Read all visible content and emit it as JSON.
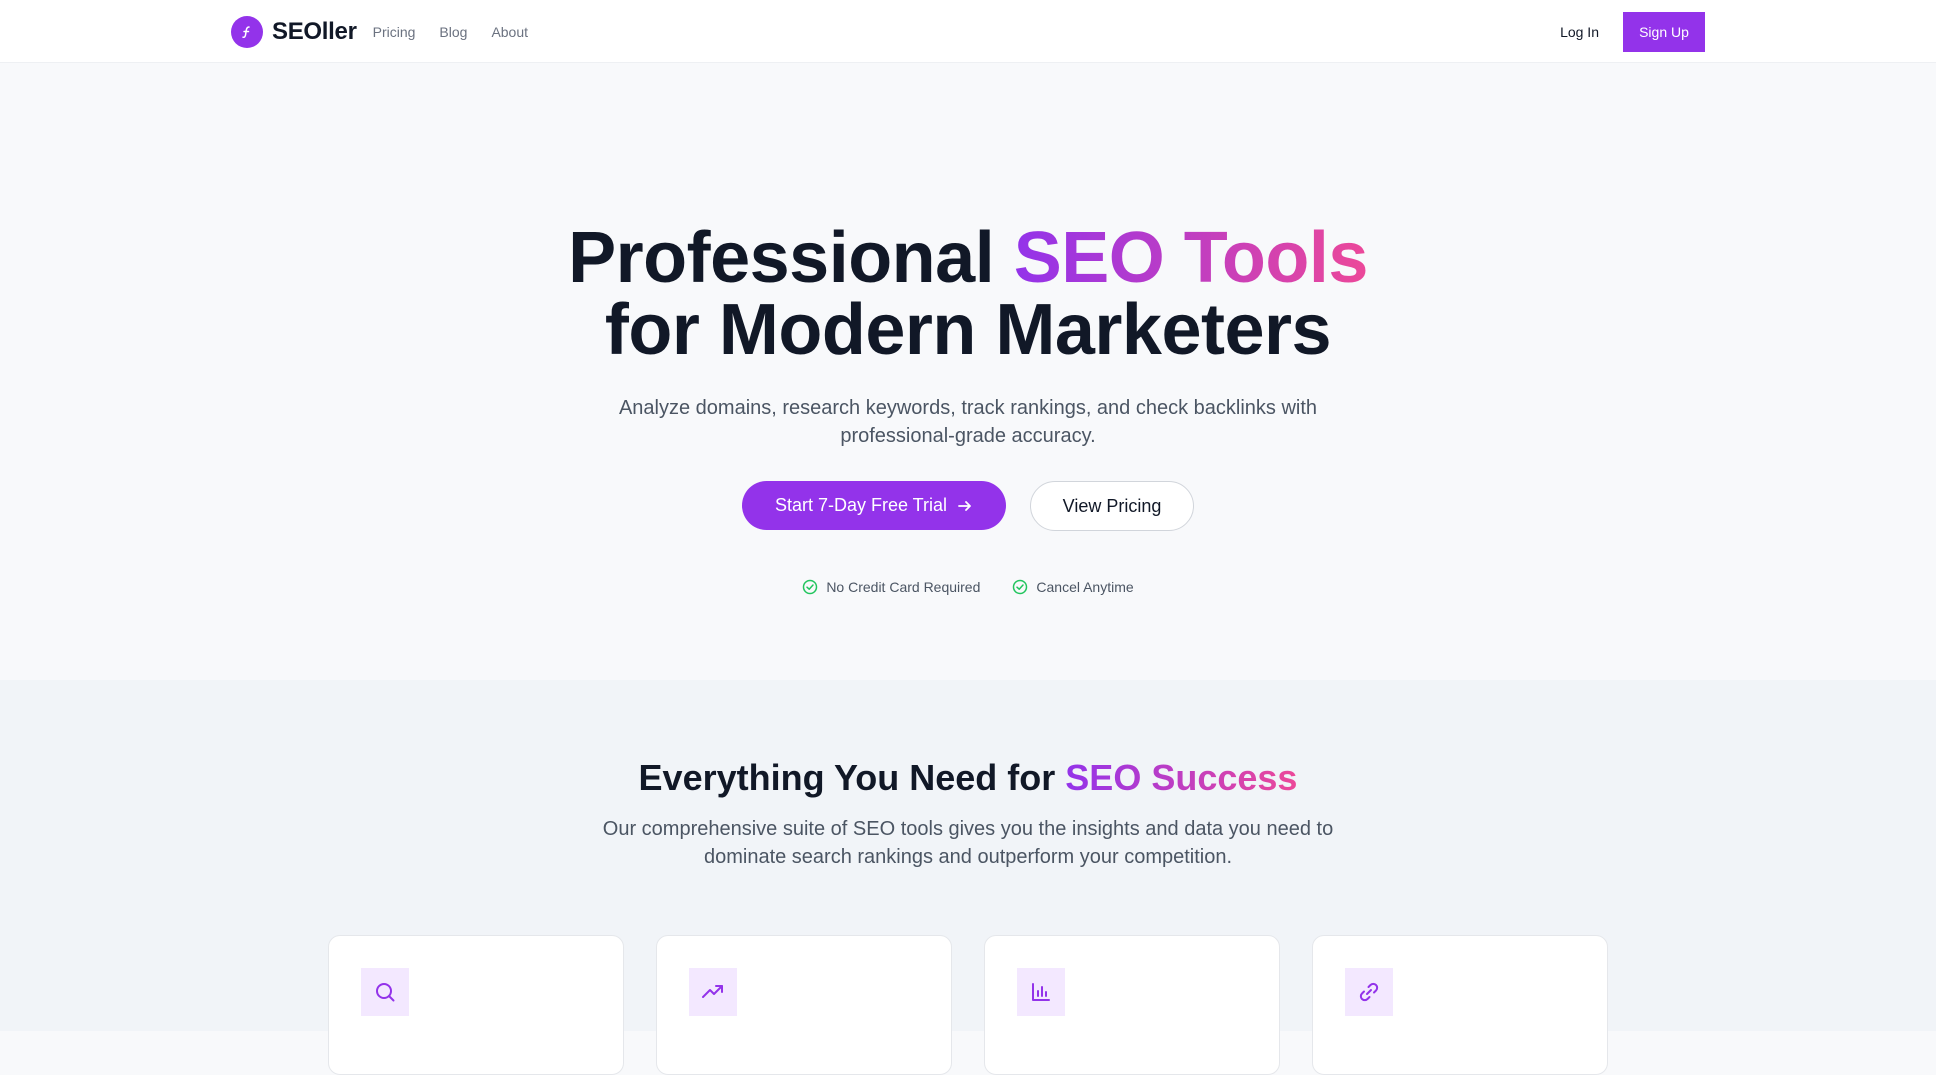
{
  "nav": {
    "brand": "SEOller",
    "links": [
      "Pricing",
      "Blog",
      "About"
    ],
    "login": "Log In",
    "signup": "Sign Up"
  },
  "hero": {
    "title_part1": "Professional ",
    "title_highlight": "SEO Tools",
    "title_part2": "for Modern Marketers",
    "subtitle": "Analyze domains, research keywords, track rankings, and check backlinks with professional-grade accuracy.",
    "cta_primary": "Start 7-Day Free Trial",
    "cta_secondary": "View Pricing",
    "badges": [
      "No Credit Card Required",
      "Cancel Anytime"
    ]
  },
  "features": {
    "title_part1": "Everything You Need for ",
    "title_highlight": "SEO Success",
    "subtitle": "Our comprehensive suite of SEO tools gives you the insights and data you need to dominate search rankings and outperform your competition.",
    "card_icons": [
      "search-icon",
      "trending-up-icon",
      "bar-chart-icon",
      "link-icon"
    ]
  },
  "colors": {
    "accent": "#9333ea",
    "accent_pink": "#ec4899",
    "check_green": "#22c55e"
  }
}
